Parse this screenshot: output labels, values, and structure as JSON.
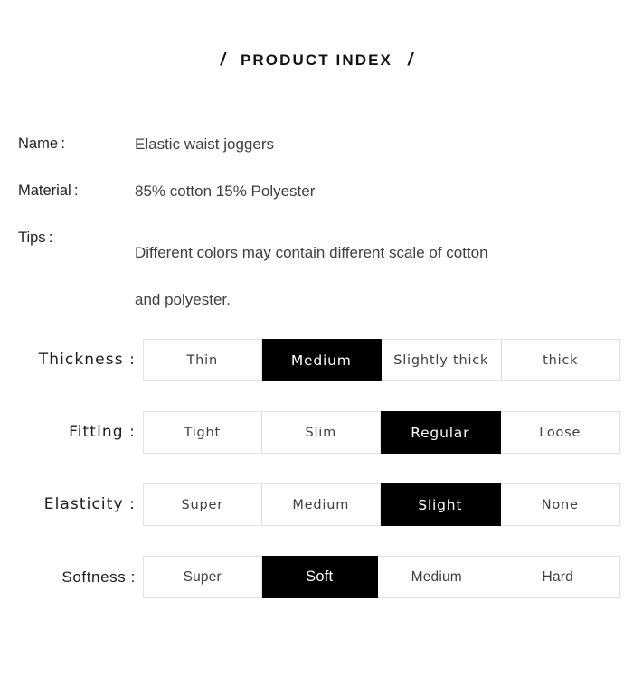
{
  "title": {
    "left_slash": "/",
    "text": "PRODUCT INDEX",
    "right_slash": "/"
  },
  "info": {
    "rows": [
      {
        "label": "Name :",
        "value": "Elastic waist joggers"
      },
      {
        "label": "Material :",
        "value": "85% cotton 15% Polyester"
      }
    ],
    "tips": {
      "label": "Tips :",
      "line1": "Different colors may contain different scale of cotton",
      "line2": "and polyester."
    }
  },
  "attributes": [
    {
      "label": "Thickness :",
      "options": [
        {
          "text": "Thin",
          "selected": false,
          "width": 131
        },
        {
          "text": "Medium",
          "selected": true,
          "width": 133
        },
        {
          "text": "Slightly thick",
          "selected": false,
          "width": 133
        },
        {
          "text": "thick",
          "selected": false,
          "width": 131
        }
      ]
    },
    {
      "label": "Fitting    :",
      "options": [
        {
          "text": "Tight",
          "selected": false,
          "width": 131
        },
        {
          "text": "Slim",
          "selected": false,
          "width": 132
        },
        {
          "text": "Regular",
          "selected": true,
          "width": 133
        },
        {
          "text": "Loose",
          "selected": false,
          "width": 132
        }
      ]
    },
    {
      "label": "Elasticity :",
      "options": [
        {
          "text": "Super",
          "selected": false,
          "width": 131
        },
        {
          "text": "Medium",
          "selected": false,
          "width": 132
        },
        {
          "text": "Slight",
          "selected": true,
          "width": 133
        },
        {
          "text": "None",
          "selected": false,
          "width": 132
        }
      ]
    },
    {
      "label": "Softness :",
      "options": [
        {
          "text": "Super",
          "selected": false,
          "width": 131
        },
        {
          "text": "Soft",
          "selected": true,
          "width": 129
        },
        {
          "text": "Medium",
          "selected": false,
          "width": 131
        },
        {
          "text": "Hard",
          "selected": false,
          "width": 137
        }
      ]
    }
  ],
  "style": {
    "selected_bg": "#000000",
    "selected_fg": "#ffffff",
    "cell_border": "#e2e2e2",
    "text_color": "#3f3f3f",
    "label_color": "#1d1d1d",
    "page_bg": "#ffffff"
  }
}
